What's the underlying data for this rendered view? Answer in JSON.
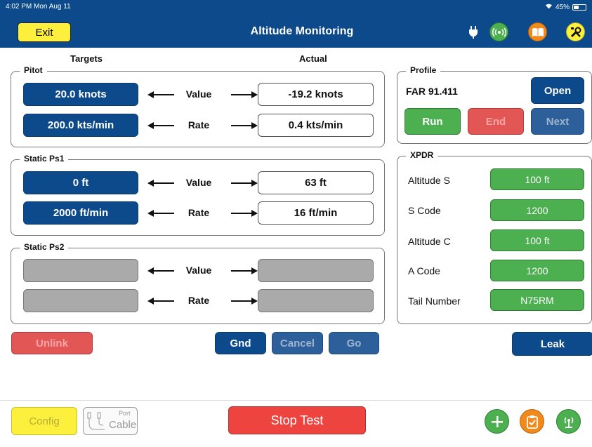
{
  "status_bar": {
    "time": "4:02 PM  Mon Aug 11",
    "battery": "45%",
    "battery_level": 0.45
  },
  "header": {
    "title": "Altitude Monitoring",
    "exit_label": "Exit",
    "icons": [
      "plug-icon",
      "broadcast-icon",
      "book-icon",
      "tools-icon"
    ],
    "colors": {
      "bar": "#0c4a8c",
      "exit": "#fdf03c",
      "green": "#4cb050",
      "orange": "#f08a1c",
      "yellow": "#fdf03c"
    }
  },
  "columns": {
    "targets": "Targets",
    "actual": "Actual"
  },
  "pitot": {
    "legend": "Pitot",
    "value_target": "20.0 knots",
    "value_label": "Value",
    "value_actual": "-19.2 knots",
    "rate_target": "200.0 kts/min",
    "rate_label": "Rate",
    "rate_actual": "0.4 kts/min"
  },
  "static1": {
    "legend": "Static Ps1",
    "value_target": "0 ft",
    "value_label": "Value",
    "value_actual": "63 ft",
    "rate_target": "2000 ft/min",
    "rate_label": "Rate",
    "rate_actual": "16 ft/min"
  },
  "static2": {
    "legend": "Static Ps2",
    "value_label": "Value",
    "rate_label": "Rate"
  },
  "controls": {
    "unlink": "Unlink",
    "gnd": "Gnd",
    "cancel": "Cancel",
    "go": "Go"
  },
  "profile": {
    "legend": "Profile",
    "name": "FAR 91.411",
    "open": "Open",
    "run": "Run",
    "end": "End",
    "next": "Next"
  },
  "xpdr": {
    "legend": "XPDR",
    "rows": [
      {
        "label": "Altitude S",
        "value": "100 ft"
      },
      {
        "label": "S Code",
        "value": "1200"
      },
      {
        "label": "Altitude C",
        "value": "100 ft"
      },
      {
        "label": "A Code",
        "value": "1200"
      },
      {
        "label": "Tail Number",
        "value": "N75RM"
      }
    ]
  },
  "leak_label": "Leak",
  "footer": {
    "config": "Config",
    "port_label": "Port",
    "cable_label": "Cable",
    "stop_test": "Stop Test",
    "icons": [
      "plus-icon",
      "clipboard-check-icon",
      "antenna-icon"
    ]
  }
}
